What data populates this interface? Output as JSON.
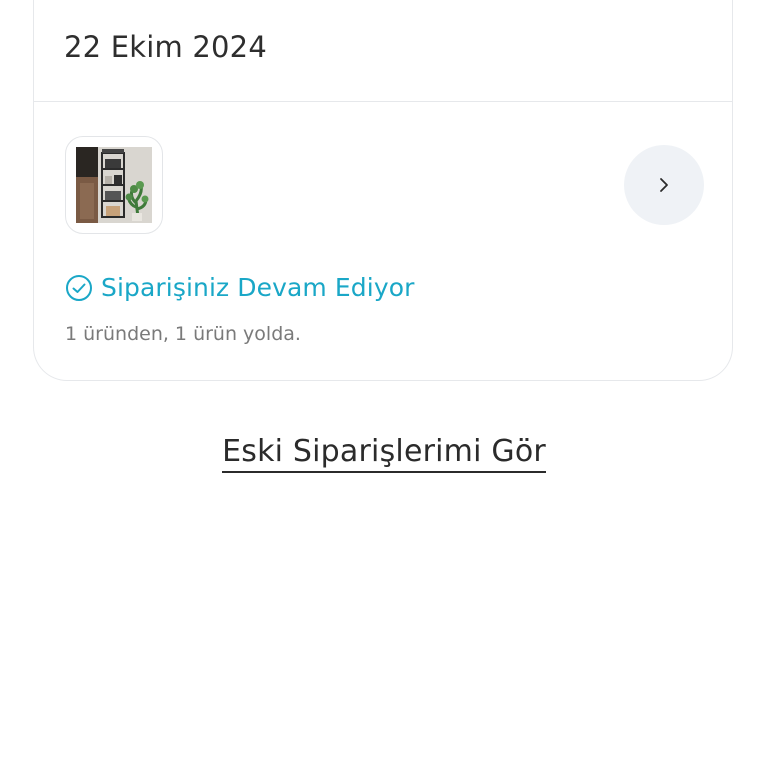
{
  "order_card": {
    "cut_text": "",
    "date": "22 Ekim 2024",
    "status": {
      "icon": "check-circle-icon",
      "text": "Siparişiniz Devam Ediyor",
      "color": "#1aa7c7"
    },
    "substatus": "1 üründen, 1 ürün yolda.",
    "detail_icon": "chevron-right-icon",
    "product_image": "shelf-product-photo"
  },
  "links": {
    "old_orders": "Eski Siparişlerimi Gör"
  }
}
